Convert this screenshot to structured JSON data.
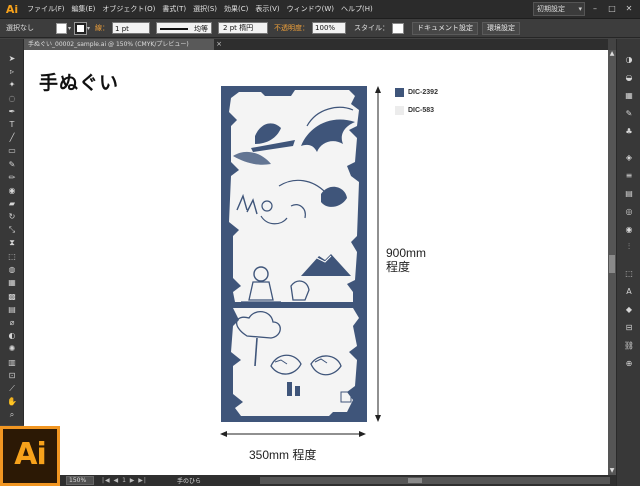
{
  "app": {
    "logo": "Ai",
    "big_logo": "Ai"
  },
  "menu": [
    "ファイル(F)",
    "編集(E)",
    "オブジェクト(O)",
    "書式(T)",
    "選択(S)",
    "効果(C)",
    "表示(V)",
    "ウィンドウ(W)",
    "ヘルプ(H)"
  ],
  "window": {
    "workspace": "初期設定",
    "minimize": "–",
    "maximize": "□",
    "close": "✕"
  },
  "control": {
    "selection": "選択なし",
    "stroke_label": "線：",
    "stroke_weight": "1 pt",
    "stroke_profile": "均等",
    "brush": "2 pt 楕円",
    "opacity_label": "不透明度：",
    "opacity": "100%",
    "style_label": "スタイル：",
    "doc_setup": "ドキュメント設定",
    "prefs": "環境設定"
  },
  "document": {
    "tab_title": "手ぬぐい_00002_sample.ai @ 150% (CMYK/プレビュー)",
    "tab_close": "×"
  },
  "artboard": {
    "title": "手ぬぐい",
    "height_label_line1": "900mm",
    "height_label_line2": "程度",
    "width_label": "350mm 程度"
  },
  "legend": [
    {
      "label": "DIC-2392",
      "color": "#3f557a"
    },
    {
      "label": "DIC-583",
      "color": "#ececec"
    }
  ],
  "colors": {
    "navy": "#3f557a",
    "light": "#ececec",
    "accent": "#f19622"
  },
  "tools_left": [
    "selection-arrow-icon",
    "direct-select-icon",
    "magic-wand-icon",
    "lasso-icon",
    "pen-icon",
    "type-icon",
    "line-icon",
    "rectangle-icon",
    "paintbrush-icon",
    "pencil-icon",
    "blob-brush-icon",
    "eraser-icon",
    "rotate-icon",
    "scale-icon",
    "width-icon",
    "free-transform-icon",
    "shape-builder-icon",
    "perspective-icon",
    "mesh-icon",
    "gradient-icon",
    "eyedropper-icon",
    "blend-icon",
    "symbol-sprayer-icon",
    "graph-icon",
    "artboard-icon",
    "slice-icon",
    "hand-icon",
    "zoom-icon"
  ],
  "panels_right": [
    "color-panel-icon",
    "color-guide-icon",
    "swatches-icon",
    "brushes-icon",
    "symbols-icon",
    "graphic-styles-icon",
    "stroke-icon",
    "gradient-panel-icon",
    "transparency-icon",
    "appearance-icon",
    "align-icon",
    "transform-icon",
    "character-icon",
    "layers-icon",
    "artboards-icon",
    "links-icon",
    "pathfinder-icon"
  ],
  "status": {
    "zoom": "150%",
    "page_nav": "|◀ ◀ 1 ▶ ▶|",
    "tool_name": "手のひら"
  }
}
